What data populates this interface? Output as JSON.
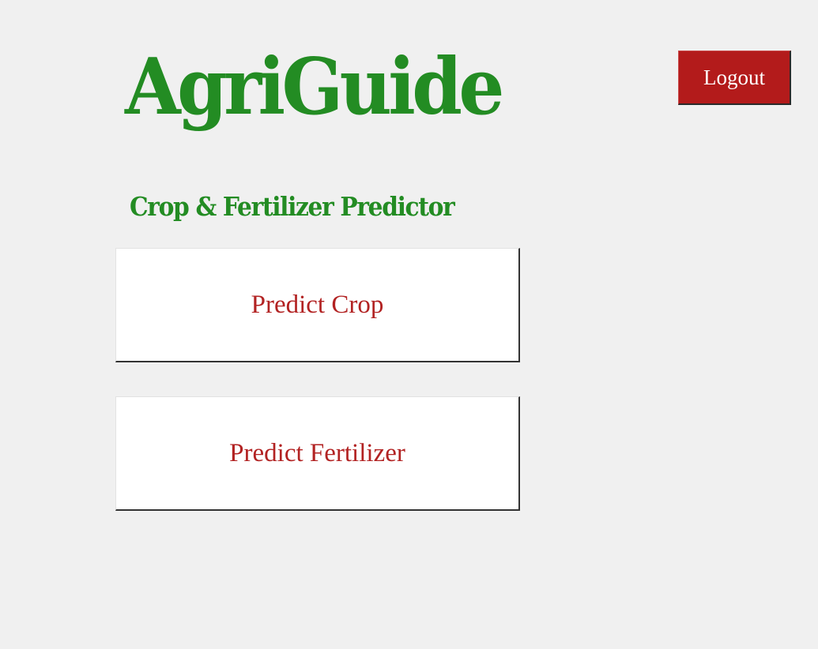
{
  "app": {
    "title": "AgriGuide",
    "subtitle": "Crop & Fertilizer Predictor"
  },
  "header": {
    "logout_label": "Logout"
  },
  "actions": {
    "predict_crop_label": "Predict Crop",
    "predict_fertilizer_label": "Predict Fertilizer"
  },
  "colors": {
    "background": "#f0f0f0",
    "brand_green": "#238c23",
    "button_text_red": "#b22222",
    "logout_red": "#b31b1b"
  }
}
